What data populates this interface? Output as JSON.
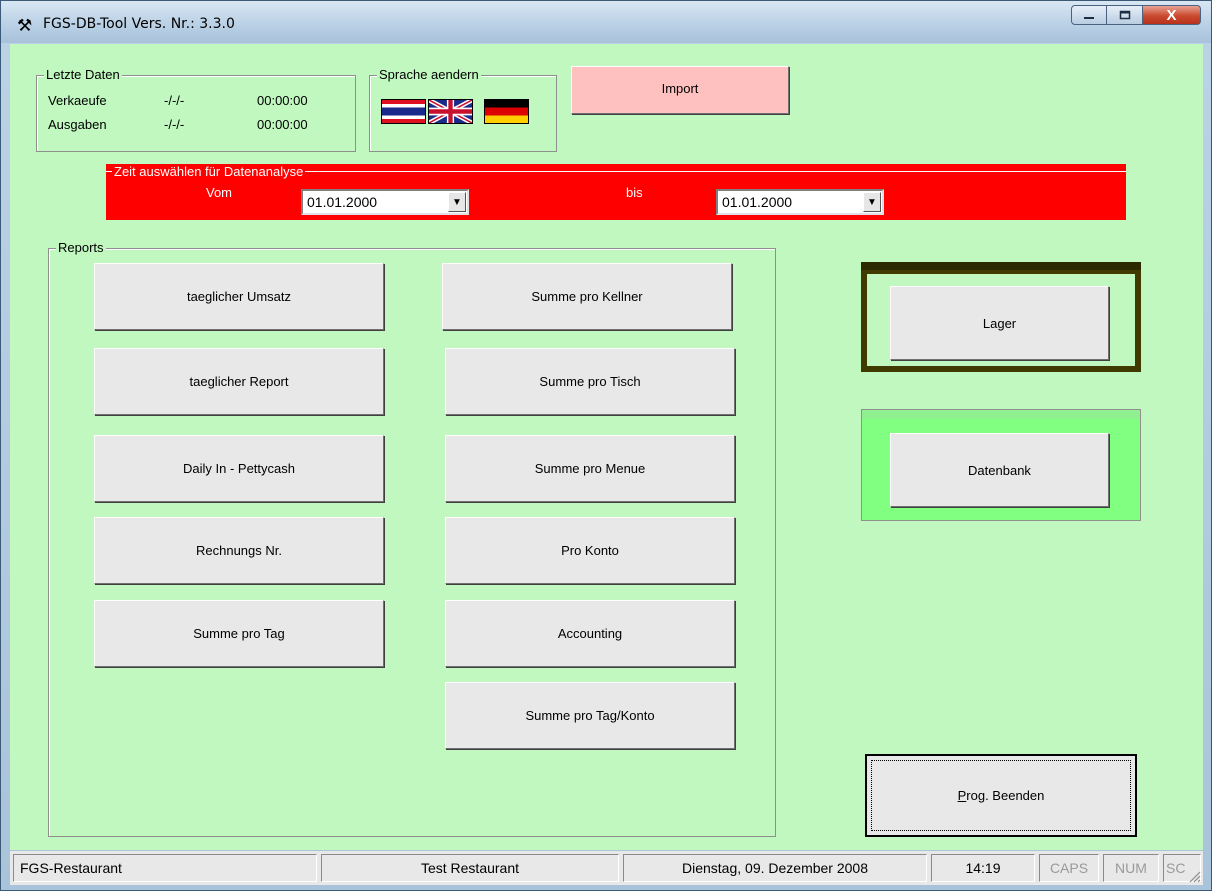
{
  "window": {
    "title": "FGS-DB-Tool  Vers. Nr.: 3.3.0",
    "icon": "hammer-wrench-icon",
    "controls": {
      "minimize": "minimize-icon",
      "maximize": "maximize-icon",
      "close": "X"
    }
  },
  "letzte_daten": {
    "label": "Letzte Daten",
    "rows": [
      {
        "name": "Verkaeufe",
        "date": "-/-/-",
        "time": "00:00:00"
      },
      {
        "name": "Ausgaben",
        "date": "-/-/-",
        "time": "00:00:00"
      }
    ]
  },
  "sprache": {
    "label": "Sprache aendern",
    "flags": [
      "thailand-flag-icon",
      "uk-flag-icon",
      "germany-flag-icon"
    ]
  },
  "import_button": {
    "label": "Import",
    "color": "#ffc0c0"
  },
  "zeit": {
    "label": "Zeit auswählen für Datenanalyse",
    "from_label": "Vom",
    "from_value": "01.01.2000",
    "to_label": "bis",
    "to_value": "01.01.2000",
    "color": "#ff0000"
  },
  "reports": {
    "label": "Reports",
    "left": [
      "taeglicher Umsatz",
      "taeglicher Report",
      "Daily In - Pettycash",
      "Rechnungs Nr.",
      "Summe pro Tag"
    ],
    "right": [
      "Summe pro Kellner",
      "Summe pro Tisch",
      "Summe pro Menue",
      "Pro Konto",
      "Accounting",
      "Summe pro Tag/Konto"
    ]
  },
  "lager": {
    "label": "Lager",
    "frame_color": "#403a00"
  },
  "datenbank": {
    "label": "Datenbank",
    "frame_color": "#80ff80"
  },
  "beenden": {
    "label_prefix": "P",
    "label_rest": "rog. Beenden"
  },
  "status": {
    "app": "FGS-Restaurant",
    "restaurant": "Test Restaurant",
    "date": "Dienstag, 09. Dezember 2008",
    "time": "14:19",
    "caps": "CAPS",
    "num": "NUM",
    "scroll": "SC"
  }
}
